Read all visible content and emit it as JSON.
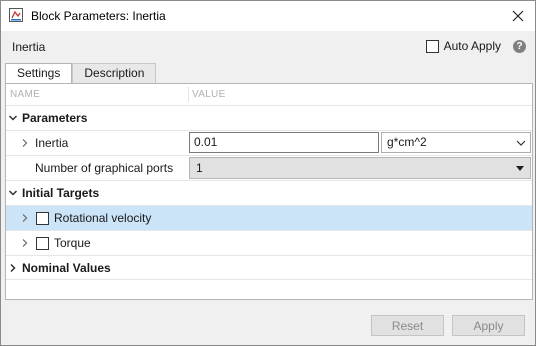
{
  "window": {
    "title": "Block Parameters: Inertia"
  },
  "header": {
    "block_name": "Inertia",
    "auto_apply_label": "Auto Apply",
    "auto_apply_checked": false
  },
  "tabs": [
    {
      "label": "Settings",
      "active": true
    },
    {
      "label": "Description",
      "active": false
    }
  ],
  "table": {
    "col_name": "NAME",
    "col_value": "VALUE",
    "sections": {
      "parameters": "Parameters",
      "initial_targets": "Initial Targets",
      "nominal_values": "Nominal Values"
    },
    "inertia": {
      "label": "Inertia",
      "value": "0.01",
      "unit": "g*cm^2"
    },
    "ports": {
      "label": "Number of graphical ports",
      "value": "1"
    },
    "rotational_velocity": {
      "label": "Rotational velocity",
      "checked": false,
      "selected": true
    },
    "torque": {
      "label": "Torque",
      "checked": false
    }
  },
  "footer": {
    "reset_label": "Reset",
    "apply_label": "Apply"
  },
  "colors": {
    "selection": "#cce4f7",
    "help_icon": "#808080"
  }
}
